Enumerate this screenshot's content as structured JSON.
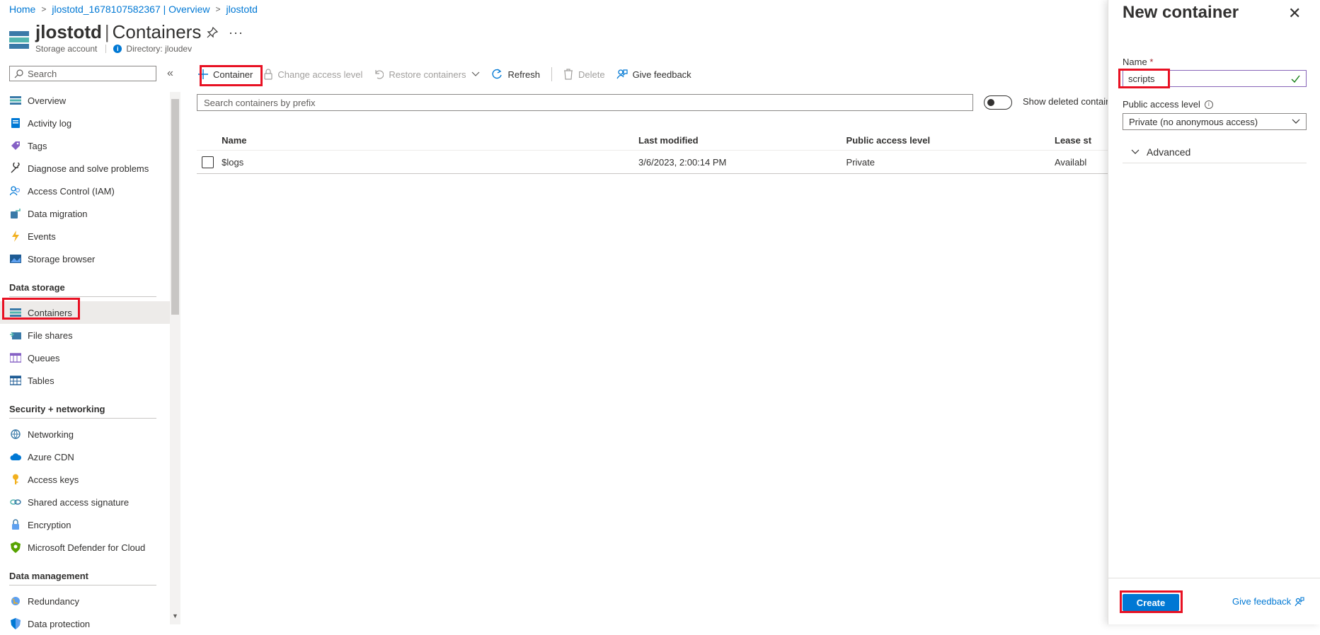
{
  "breadcrumb": [
    "Home",
    "jlostotd_1678107582367 | Overview",
    "jlostotd"
  ],
  "header": {
    "resource_name": "jlostotd",
    "section": "Containers",
    "subtitle": "Storage account",
    "directory": "Directory: jloudev",
    "more": "···"
  },
  "sidebar": {
    "search_placeholder": "Search",
    "items_top": [
      {
        "label": "Overview",
        "icon": "overview-icon"
      },
      {
        "label": "Activity log",
        "icon": "activity-log-icon"
      },
      {
        "label": "Tags",
        "icon": "tag-icon"
      },
      {
        "label": "Diagnose and solve problems",
        "icon": "wrench-icon"
      },
      {
        "label": "Access Control (IAM)",
        "icon": "people-icon"
      },
      {
        "label": "Data migration",
        "icon": "data-migration-icon"
      },
      {
        "label": "Events",
        "icon": "lightning-icon"
      },
      {
        "label": "Storage browser",
        "icon": "storage-browser-icon"
      }
    ],
    "section_data_storage": "Data storage",
    "items_data_storage": [
      {
        "label": "Containers",
        "icon": "containers-icon"
      },
      {
        "label": "File shares",
        "icon": "file-shares-icon"
      },
      {
        "label": "Queues",
        "icon": "queues-icon"
      },
      {
        "label": "Tables",
        "icon": "tables-icon"
      }
    ],
    "section_security": "Security + networking",
    "items_security": [
      {
        "label": "Networking",
        "icon": "networking-icon"
      },
      {
        "label": "Azure CDN",
        "icon": "cloud-icon"
      },
      {
        "label": "Access keys",
        "icon": "key-icon"
      },
      {
        "label": "Shared access signature",
        "icon": "link-icon"
      },
      {
        "label": "Encryption",
        "icon": "lock-icon"
      },
      {
        "label": "Microsoft Defender for Cloud",
        "icon": "shield-icon"
      }
    ],
    "section_data_management": "Data management",
    "items_data_management": [
      {
        "label": "Redundancy",
        "icon": "globe-icon"
      },
      {
        "label": "Data protection",
        "icon": "shield-blue-icon"
      }
    ]
  },
  "toolbar": {
    "container": "Container",
    "change_access": "Change access level",
    "restore": "Restore containers",
    "refresh": "Refresh",
    "delete": "Delete",
    "feedback": "Give feedback"
  },
  "list": {
    "search_placeholder": "Search containers by prefix",
    "show_deleted": "Show deleted contair",
    "columns": [
      "Name",
      "Last modified",
      "Public access level",
      "Lease st"
    ],
    "rows": [
      {
        "name": "$logs",
        "modified": "3/6/2023, 2:00:14 PM",
        "access": "Private",
        "lease": "Availabl"
      }
    ]
  },
  "panel": {
    "title": "New container",
    "name_label": "Name",
    "required_mark": "*",
    "name_value": "scripts",
    "access_label": "Public access level",
    "access_value": "Private (no anonymous access)",
    "advanced": "Advanced",
    "create": "Create",
    "feedback": "Give feedback"
  },
  "colors": {
    "accent": "#0078d4",
    "highlight": "#e81123"
  }
}
